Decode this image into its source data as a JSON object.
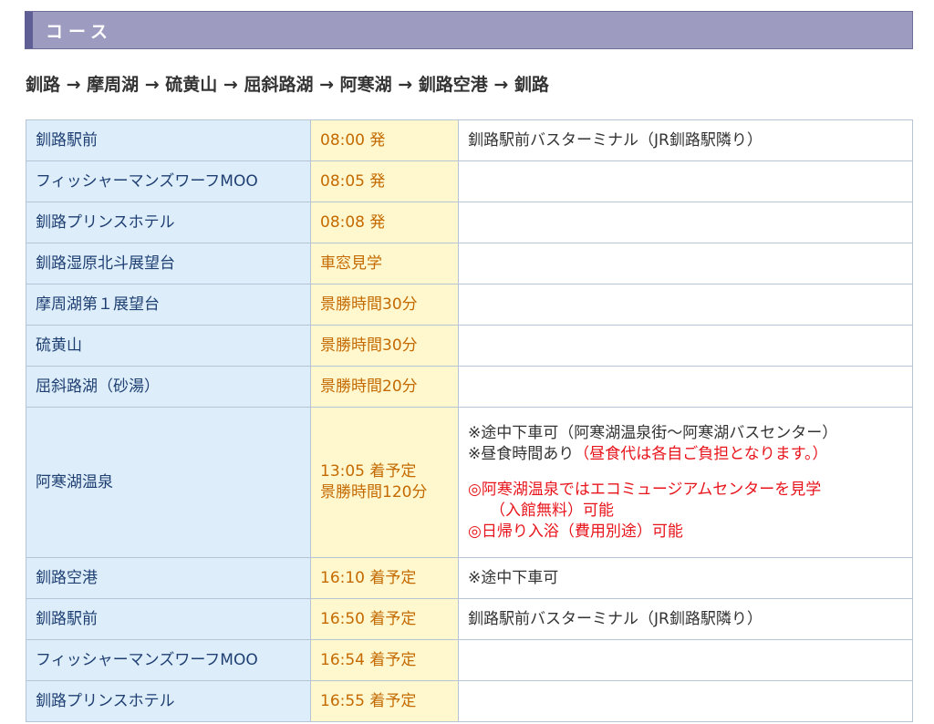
{
  "section": {
    "title": "コース"
  },
  "route": "釧路 → 摩周湖 → 硫黄山 → 屈斜路湖 → 阿寒湖 → 釧路空港 → 釧路",
  "rows": [
    {
      "stop": "釧路駅前",
      "time": "08:00 発",
      "note": "釧路駅前バスターミナル（JR釧路駅隣り）"
    },
    {
      "stop": "フィッシャーマンズワーフMOO",
      "time": "08:05 発",
      "note": ""
    },
    {
      "stop": "釧路プリンスホテル",
      "time": "08:08 発",
      "note": ""
    },
    {
      "stop": "釧路湿原北斗展望台",
      "time": "車窓見学",
      "note": ""
    },
    {
      "stop": "摩周湖第１展望台",
      "time": "景勝時間30分",
      "note": ""
    },
    {
      "stop": "硫黄山",
      "time": "景勝時間30分",
      "note": ""
    },
    {
      "stop": "屈斜路湖（砂湯）",
      "time": "景勝時間20分",
      "note": ""
    },
    {
      "stop": "阿寒湖温泉",
      "time_line1": "13:05 着予定",
      "time_line2": "景勝時間120分",
      "note_line1": "※途中下車可（阿寒湖温泉街〜阿寒湖バスセンター）",
      "note_line2_black": "※昼食時間あり",
      "note_line2_red": "（昼食代は各自ご負担となります。）",
      "note_line3": "◎阿寒湖温泉ではエコミュージアムセンターを見学",
      "note_line4": "（入館無料）可能",
      "note_line5": "◎日帰り入浴（費用別途）可能"
    },
    {
      "stop": "釧路空港",
      "time": "16:10 着予定",
      "note": "※途中下車可"
    },
    {
      "stop": "釧路駅前",
      "time": "16:50 着予定",
      "note": "釧路駅前バスターミナル（JR釧路駅隣り）"
    },
    {
      "stop": "フィッシャーマンズワーフMOO",
      "time": "16:54 着予定",
      "note": ""
    },
    {
      "stop": "釧路プリンスホテル",
      "time": "16:55 着予定",
      "note": ""
    }
  ],
  "colors": {
    "header_bg": "#9d9cc0",
    "stop_bg": "#ddeefa",
    "time_bg": "#fff8cf",
    "time_text": "#c46a00",
    "warning_text": "#e8141b"
  }
}
